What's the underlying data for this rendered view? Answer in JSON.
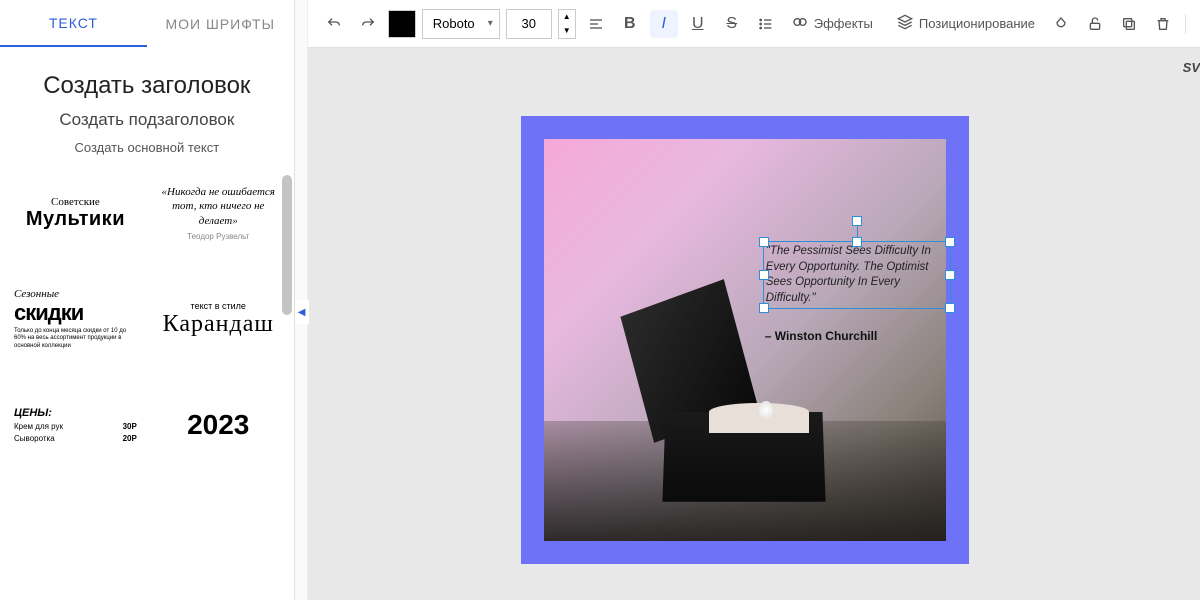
{
  "sidebar": {
    "tabs": {
      "text": "ТЕКСТ",
      "my_fonts": "МОИ ШРИФТЫ"
    },
    "presets": {
      "heading": "Создать заголовок",
      "subheading": "Создать подзаголовок",
      "body": "Создать основной текст"
    },
    "templates": {
      "card1": {
        "line1": "Советские",
        "line2": "Мультики"
      },
      "card2": {
        "quote": "«Никогда не ошибается тот, кто ничего не делает»",
        "author": "Теодор Рузвельт"
      },
      "card3": {
        "line1": "Сезонные",
        "line2": "скидки",
        "sub": "Только до конца месяца скидки от 10 до 60% на весь ассортимент продукции в основной коллекции"
      },
      "card4": {
        "line1": "текст в стиле",
        "line2": "Карандаш"
      },
      "card5": {
        "title": "ЦЕНЫ:",
        "row1_label": "Крем для рук",
        "row1_price": "30Р",
        "row2_label": "Сыворотка",
        "row2_price": "20Р"
      },
      "card6": {
        "year": "2023"
      }
    }
  },
  "toolbar": {
    "font": "Roboto",
    "size": "30",
    "effects": "Эффекты",
    "positioning": "Позиционирование"
  },
  "canvas": {
    "quote": "\"The Pessimist Sees Difficulty In Every Opportunity. The Optimist Sees Opportunity In Every Difficulty.\"",
    "author": "– Winston Churchill"
  },
  "right_crop": "SV"
}
